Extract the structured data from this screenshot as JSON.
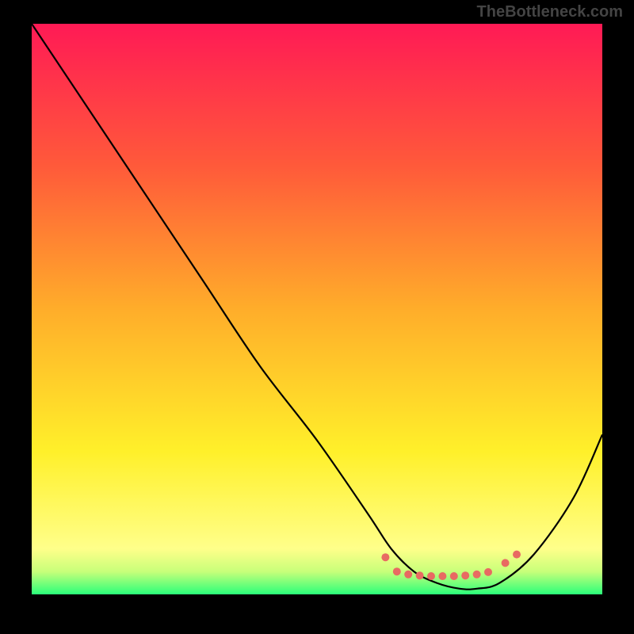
{
  "watermark": "TheBottleneck.com",
  "chart_data": {
    "type": "line",
    "title": "",
    "xlabel": "",
    "ylabel": "",
    "xlim": [
      0,
      100
    ],
    "ylim": [
      0,
      100
    ],
    "background_gradient": {
      "stops": [
        {
          "offset": 0,
          "color": "#ff1a55"
        },
        {
          "offset": 25,
          "color": "#ff5a3a"
        },
        {
          "offset": 50,
          "color": "#ffad2a"
        },
        {
          "offset": 75,
          "color": "#fff02a"
        },
        {
          "offset": 92,
          "color": "#ffff8a"
        },
        {
          "offset": 96,
          "color": "#c8ff7a"
        },
        {
          "offset": 100,
          "color": "#2aff7a"
        }
      ]
    },
    "series": [
      {
        "name": "bottleneck-curve",
        "color": "#000000",
        "x": [
          0,
          10,
          20,
          30,
          40,
          50,
          59,
          63,
          67,
          71,
          75,
          78,
          82,
          88,
          95,
          100
        ],
        "y": [
          100,
          85,
          70,
          55,
          40,
          27,
          14,
          8,
          4,
          2,
          1,
          1,
          2,
          7,
          17,
          28
        ]
      }
    ],
    "dotted_region": {
      "name": "optimal-range-dots",
      "color": "#e86a62",
      "points": [
        {
          "x": 62,
          "y": 6.5
        },
        {
          "x": 64,
          "y": 4.0
        },
        {
          "x": 66,
          "y": 3.5
        },
        {
          "x": 68,
          "y": 3.3
        },
        {
          "x": 70,
          "y": 3.2
        },
        {
          "x": 72,
          "y": 3.2
        },
        {
          "x": 74,
          "y": 3.2
        },
        {
          "x": 76,
          "y": 3.3
        },
        {
          "x": 78,
          "y": 3.5
        },
        {
          "x": 80,
          "y": 3.9
        },
        {
          "x": 83,
          "y": 5.5
        },
        {
          "x": 85,
          "y": 7.0
        }
      ]
    }
  }
}
